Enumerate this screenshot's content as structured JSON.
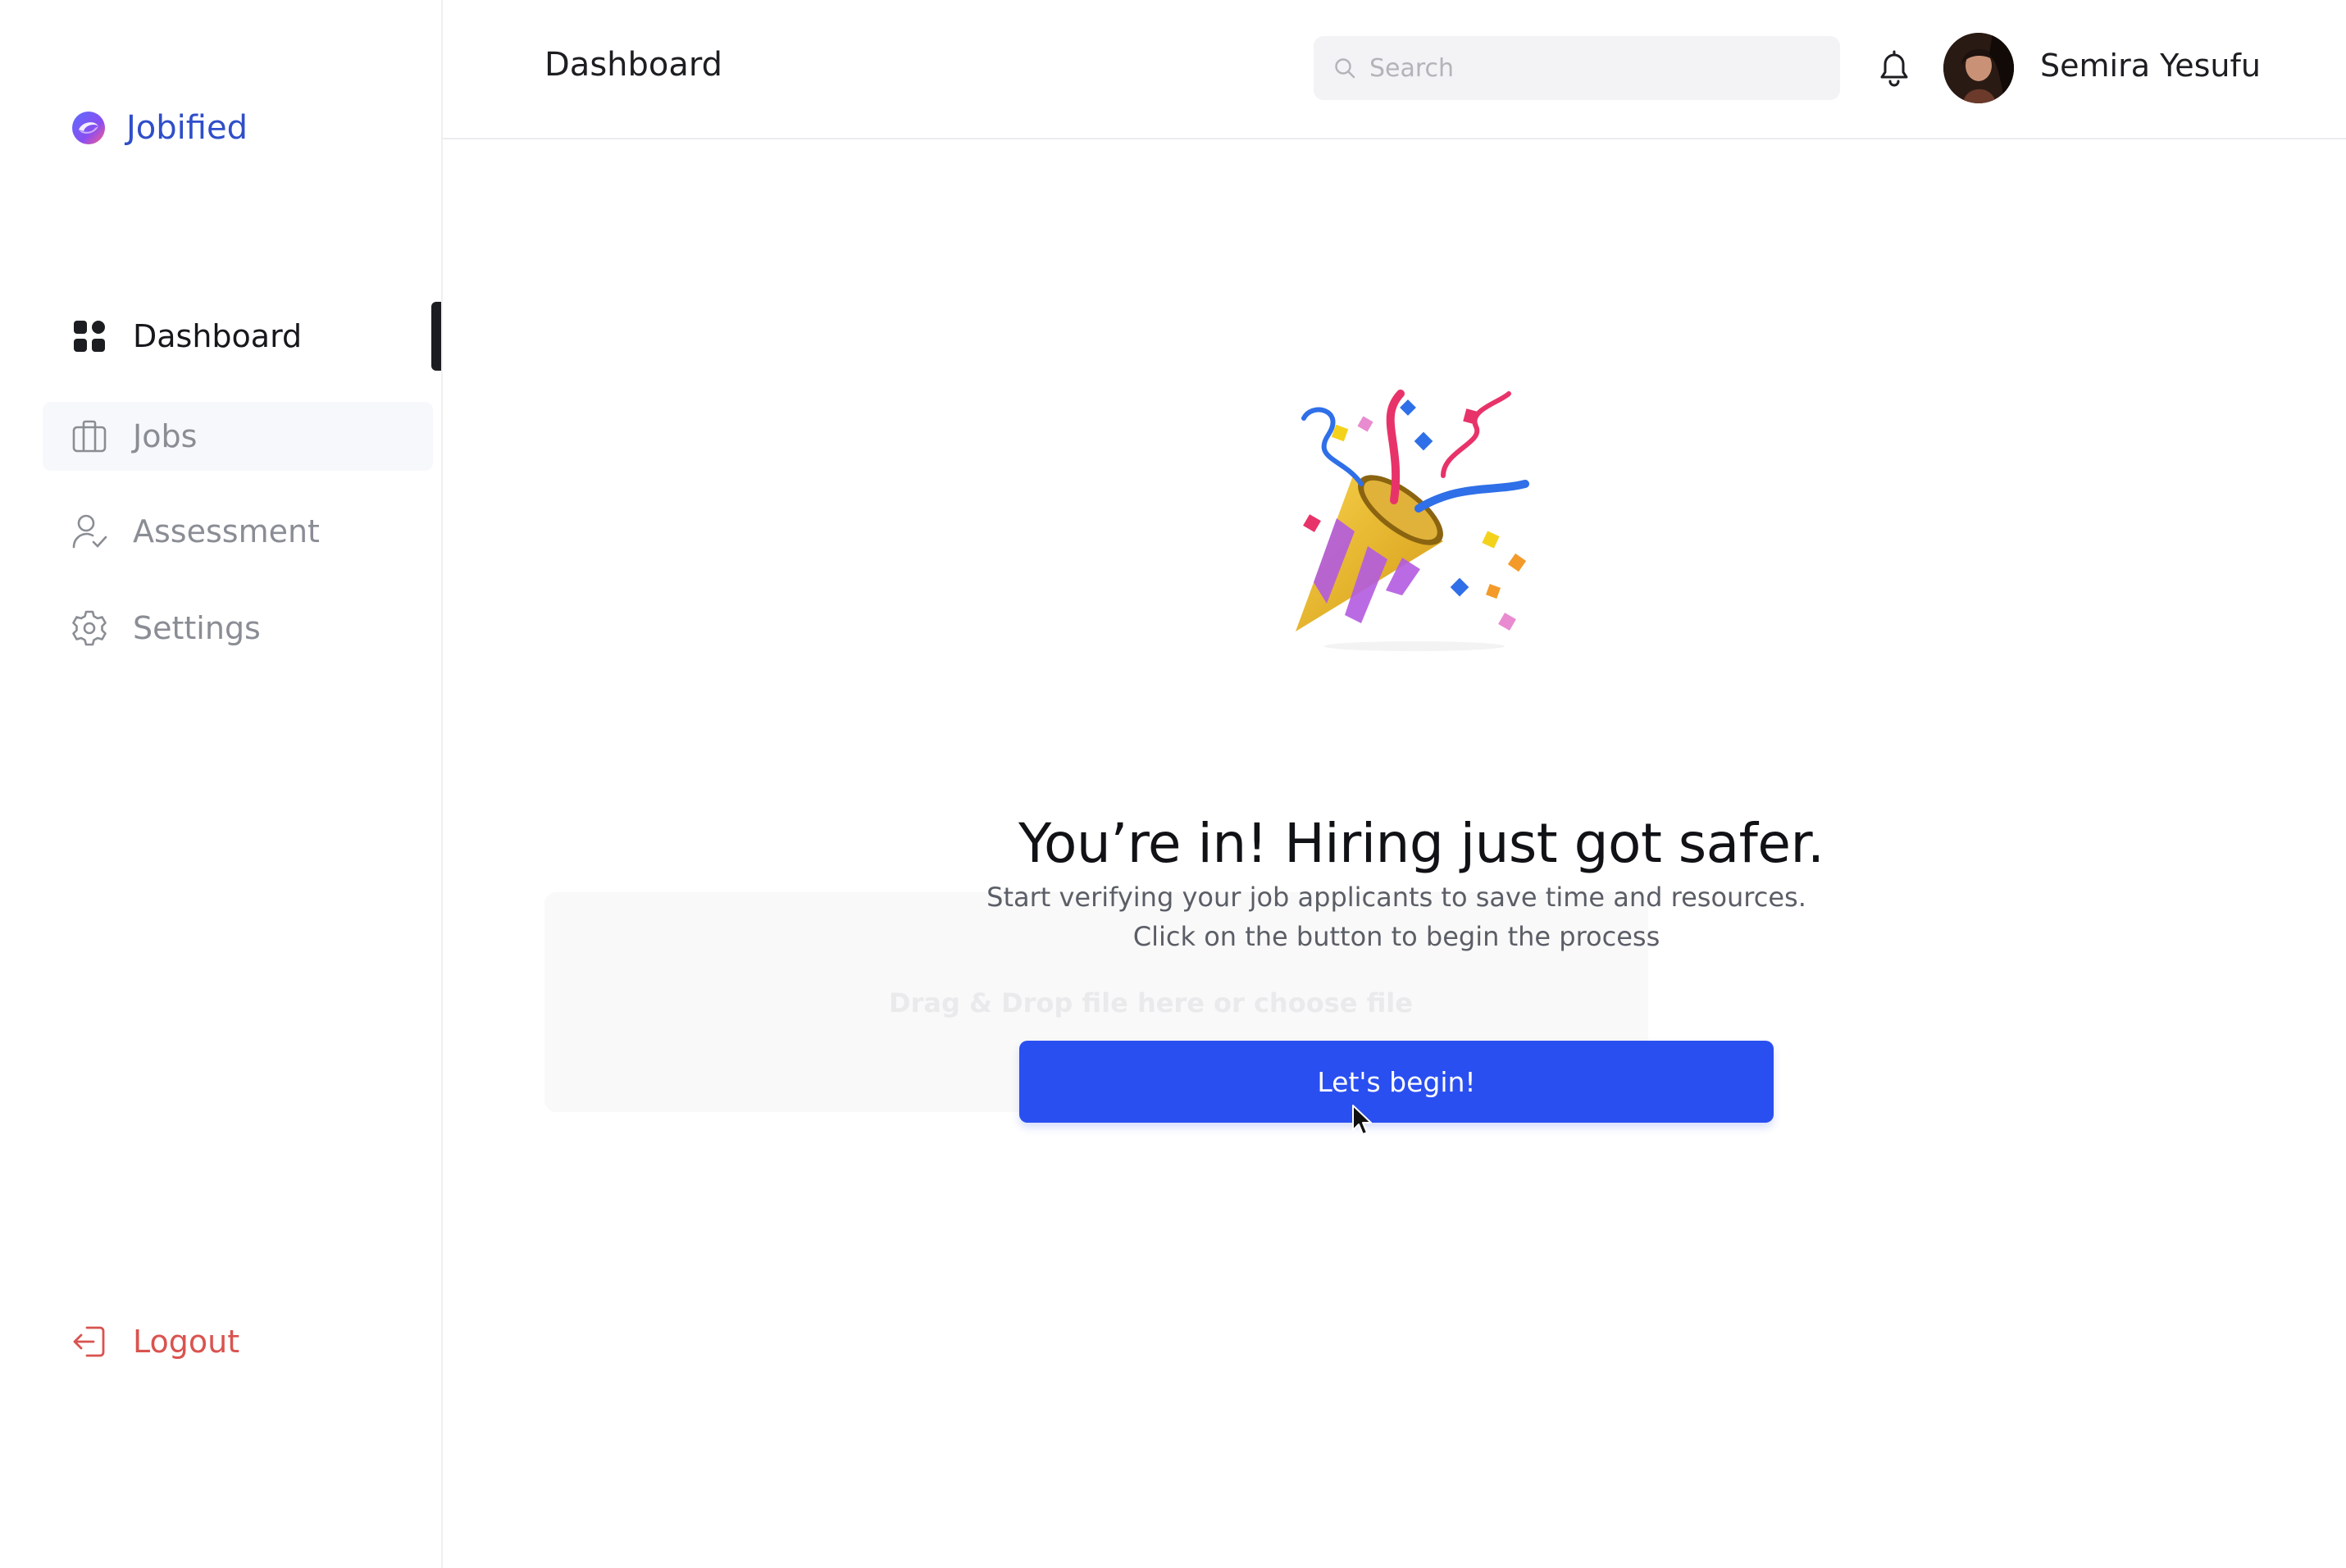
{
  "app": {
    "name": "Jobified"
  },
  "sidebar": {
    "items": [
      {
        "label": "Dashboard",
        "icon": "grid-icon",
        "active": true
      },
      {
        "label": "Jobs",
        "icon": "briefcase-icon",
        "active": false
      },
      {
        "label": "Assessment",
        "icon": "user-check-icon",
        "active": false
      },
      {
        "label": "Settings",
        "icon": "gear-icon",
        "active": false
      }
    ],
    "logout_label": "Logout"
  },
  "header": {
    "title": "Dashboard",
    "search_placeholder": "Search",
    "user_name": "Semira Yesufu"
  },
  "main": {
    "headline": "You’re in! Hiring just got safer.",
    "subtext_line1": "Start verifying your job applicants to save time and resources.",
    "subtext_line2": "Click on the button to begin the process",
    "cta_label": "Let's begin!",
    "ghost_text": "Drag & Drop file here or choose file"
  },
  "colors": {
    "brand": "#2f4ec9",
    "cta": "#2a4ff0",
    "logout": "#d9534f",
    "inactive_text": "#8a8d94"
  }
}
